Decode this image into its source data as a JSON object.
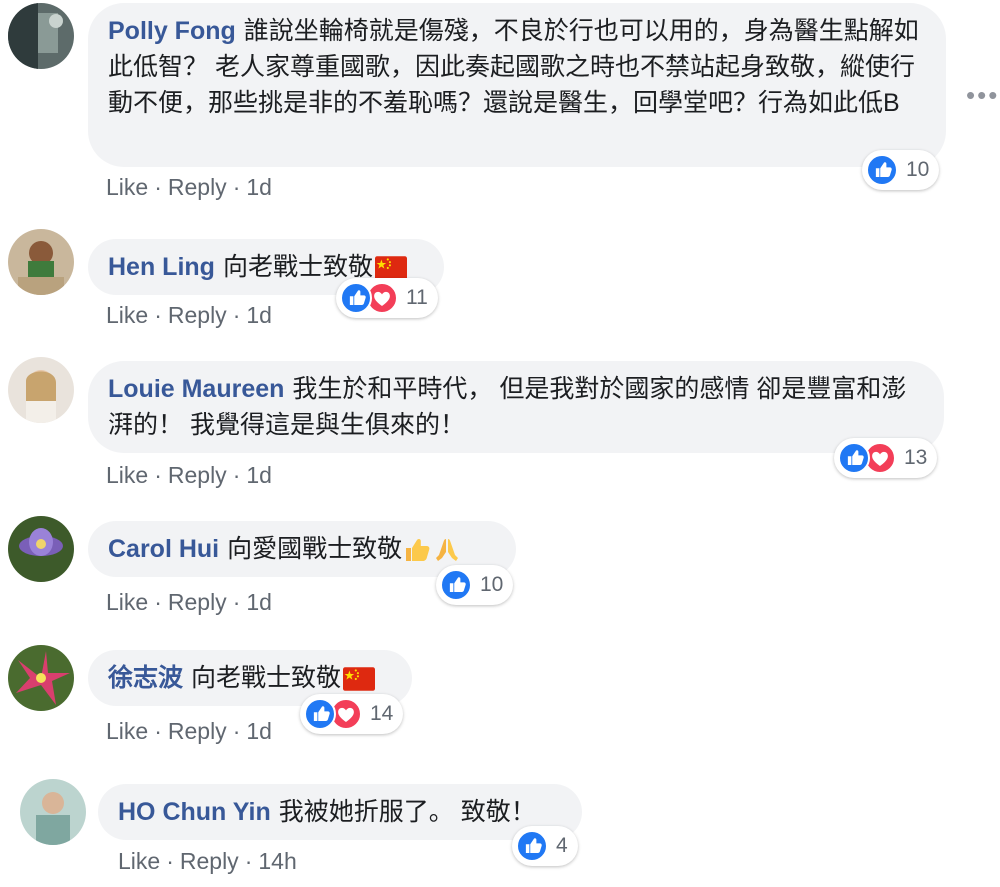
{
  "comments": [
    {
      "author": "Polly Fong",
      "text": "誰說坐輪椅就是傷殘，不良於行也可以用的，身為醫生點解如此低智？ 老人家尊重國歌，因此奏起國歌之時也不禁站起身致敬，縱使行動不便，那些挑是非的不羞恥嗎？還說是醫生，回學堂吧？行為如此低B",
      "like": "Like",
      "reply": "Reply",
      "time": "1d",
      "reaction_count": "10",
      "reaction_types": [
        "like"
      ]
    },
    {
      "author": "Hen Ling",
      "text": "向老戰士致敬",
      "emoji": "china-flag",
      "like": "Like",
      "reply": "Reply",
      "time": "1d",
      "reaction_count": "11",
      "reaction_types": [
        "like",
        "love"
      ]
    },
    {
      "author": "Louie Maureen",
      "text": "我生於和平時代， 但是我對於國家的感情 卻是豐富和澎湃的！ 我覺得這是與生俱來的！",
      "like": "Like",
      "reply": "Reply",
      "time": "1d",
      "reaction_count": "13",
      "reaction_types": [
        "like",
        "love"
      ]
    },
    {
      "author": "Carol Hui",
      "text": "向愛國戰士致敬",
      "emoji": "thumbs-up, folded-hands",
      "like": "Like",
      "reply": "Reply",
      "time": "1d",
      "reaction_count": "10",
      "reaction_types": [
        "like"
      ]
    },
    {
      "author": "徐志波",
      "text": "向老戰士致敬",
      "emoji": "china-flag",
      "like": "Like",
      "reply": "Reply",
      "time": "1d",
      "reaction_count": "14",
      "reaction_types": [
        "like",
        "love"
      ]
    },
    {
      "author": "HO Chun Yin",
      "text": "我被她折服了。 致敬！",
      "like": "Like",
      "reply": "Reply",
      "time": "14h",
      "reaction_count": "4",
      "reaction_types": [
        "like"
      ]
    }
  ],
  "colors": {
    "author": "#385898",
    "bubble": "#f2f3f5",
    "meta": "#606770",
    "like_blue": "#2078f4",
    "love_red": "#f33e58"
  },
  "icons": {
    "more": "more-options-icon",
    "like": "like-reaction-icon",
    "love": "love-reaction-icon"
  }
}
